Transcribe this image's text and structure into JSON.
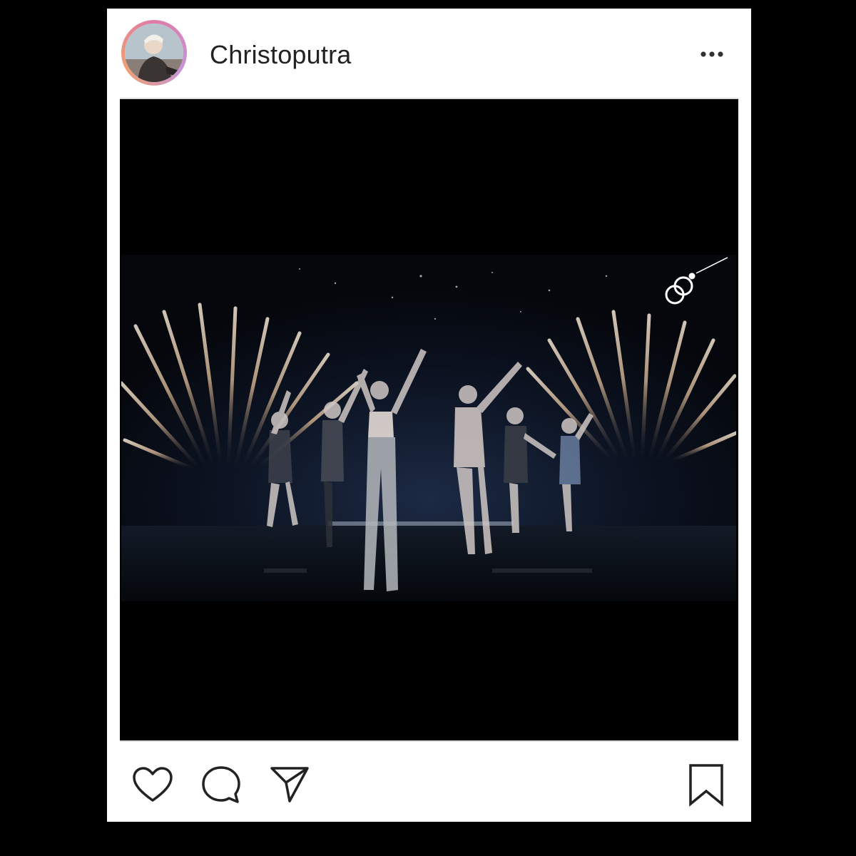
{
  "post": {
    "username": "Christoputra",
    "more_icon": "more-horizontal-icon",
    "media": {
      "type": "video",
      "watermark_icon": "broadcaster-logo-icon"
    },
    "actions": {
      "like_icon": "heart-icon",
      "comment_icon": "comment-bubble-icon",
      "share_icon": "paper-plane-icon",
      "save_icon": "bookmark-icon"
    }
  }
}
